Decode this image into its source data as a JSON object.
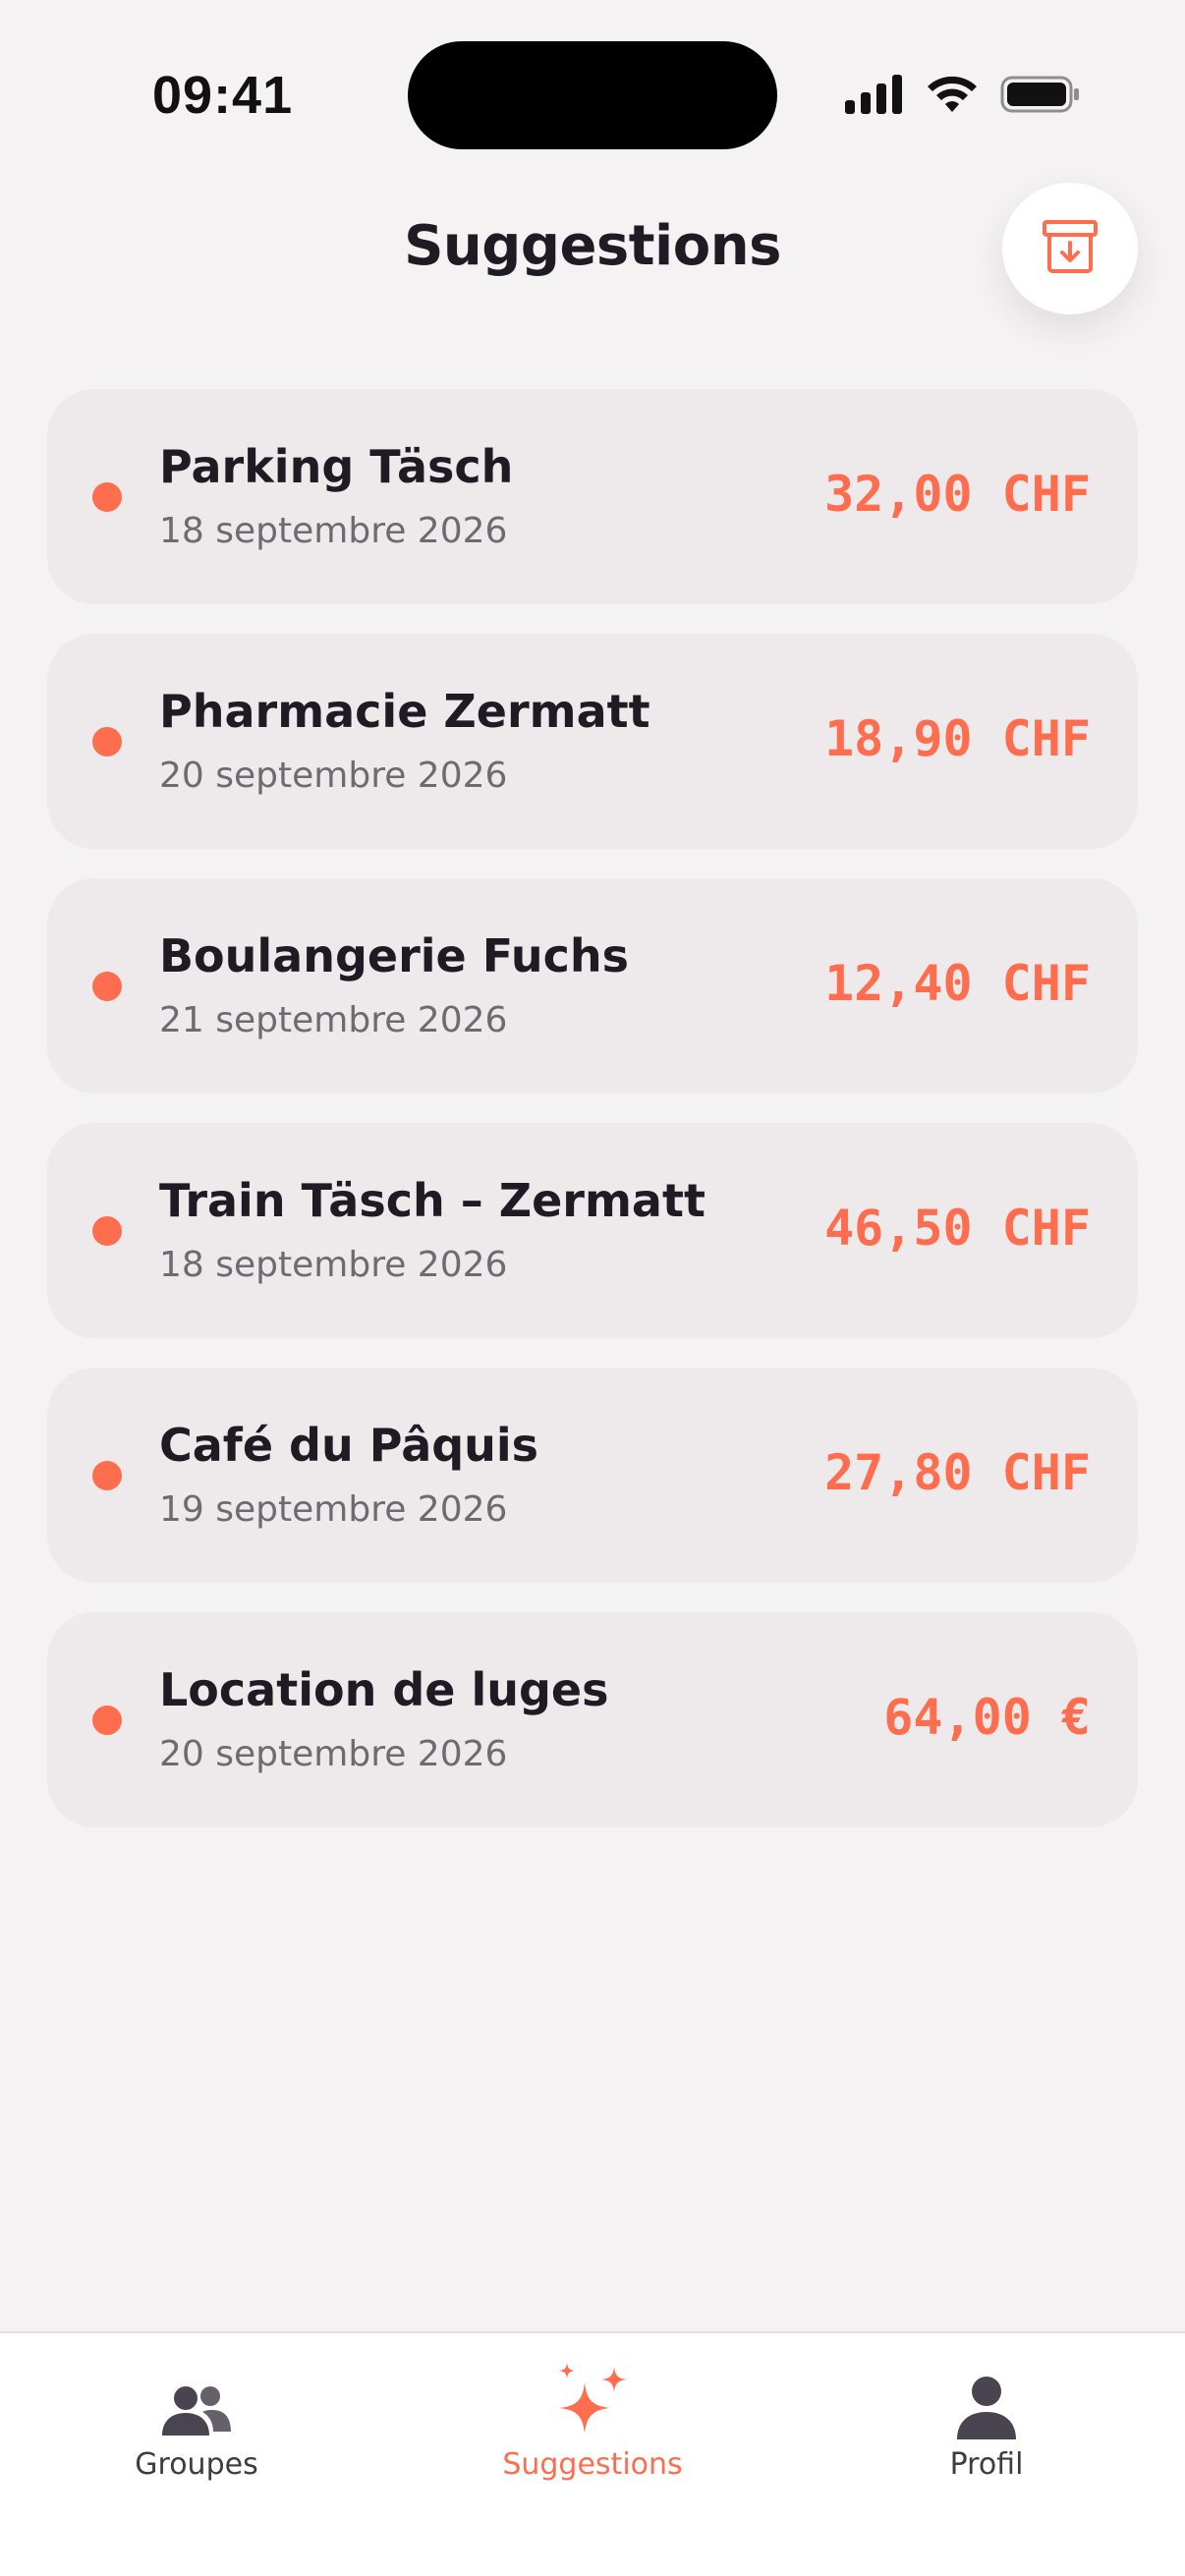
{
  "status_bar": {
    "time": "09:41"
  },
  "header": {
    "title": "Suggestions",
    "archive_icon": "archive-download-icon"
  },
  "colors": {
    "accent": "#fe6d4e",
    "background": "#f5f2f3",
    "card": "#eeeaec",
    "text": "#1f1a24",
    "muted": "#6e6a70"
  },
  "suggestions": [
    {
      "name": "Parking Täsch",
      "date": "18 septembre 2026",
      "amount": "32,00 CHF"
    },
    {
      "name": "Pharmacie Zermatt",
      "date": "20 septembre 2026",
      "amount": "18,90 CHF"
    },
    {
      "name": "Boulangerie Fuchs",
      "date": "21 septembre 2026",
      "amount": "12,40 CHF"
    },
    {
      "name": "Train Täsch – Zermatt",
      "date": "18 septembre 2026",
      "amount": "46,50 CHF"
    },
    {
      "name": "Café du Pâquis",
      "date": "19 septembre 2026",
      "amount": "27,80 CHF"
    },
    {
      "name": "Location de luges",
      "date": "20 septembre 2026",
      "amount": "64,00 €"
    }
  ],
  "tab_bar": {
    "tabs": [
      {
        "label": "Groupes",
        "icon": "group-icon",
        "active": false
      },
      {
        "label": "Suggestions",
        "icon": "sparkles-icon",
        "active": true
      },
      {
        "label": "Profil",
        "icon": "person-icon",
        "active": false
      }
    ]
  }
}
